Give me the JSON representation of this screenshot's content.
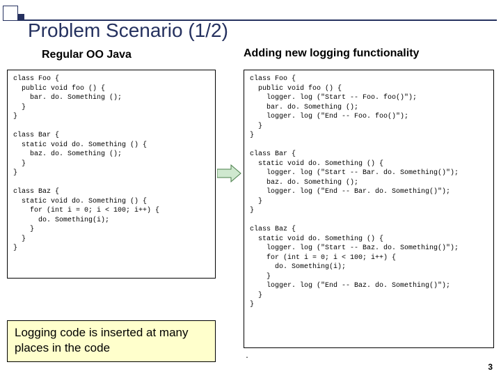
{
  "slide": {
    "title": "Problem Scenario (1/2)",
    "subtitle_left": "Regular OO Java",
    "subtitle_right": "Adding new logging functionality",
    "code_left": "class Foo {\n  public void foo () {\n    bar. do. Something ();\n  }\n}\n\nclass Bar {\n  static void do. Something () {\n    baz. do. Something ();\n  }\n}\n\nclass Baz {\n  static void do. Something () {\n    for (int i = 0; i < 100; i++) {\n      do. Something(i);\n    }\n  }\n}",
    "code_right": "class Foo {\n  public void foo () {\n    logger. log (\"Start -- Foo. foo()\");\n    bar. do. Something ();\n    logger. log (\"End -- Foo. foo()\");\n  }\n}\n\nclass Bar {\n  static void do. Something () {\n    logger. log (\"Start -- Bar. do. Something()\");\n    baz. do. Something ();\n    logger. log (\"End -- Bar. do. Something()\");\n  }\n}\n\nclass Baz {\n  static void do. Something () {\n    logger. log (\"Start -- Baz. do. Something()\");\n    for (int i = 0; i < 100; i++) {\n      do. Something(i);\n    }\n    logger. log (\"End -- Baz. do. Something()\");\n  }\n}",
    "note": "Logging code is inserted at many places in the code",
    "slide_number": "3",
    "trailing_dot": "."
  }
}
